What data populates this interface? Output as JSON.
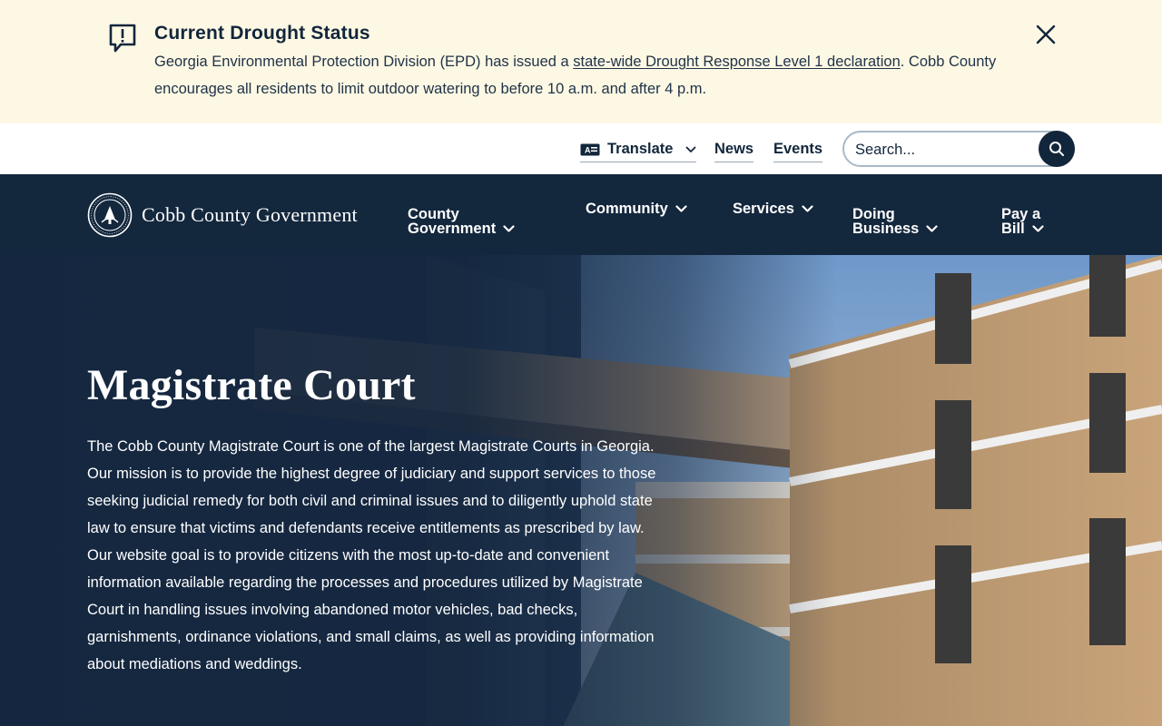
{
  "alert": {
    "title": "Current Drought Status",
    "text_before": "Georgia Environmental Protection Division (EPD) has issued a ",
    "link_text": "state-wide Drought Response Level 1 declaration",
    "text_after": ". Cobb County encourages all residents to limit outdoor watering to before 10 a.m. and after 4 p.m.",
    "background_color": "#fdf8e4",
    "icon": "alert-speech-bubble-icon"
  },
  "utility": {
    "translate_label": "Translate",
    "news_label": "News",
    "events_label": "Events",
    "search_placeholder": "Search..."
  },
  "nav": {
    "logo_text": "Cobb County Government",
    "items": [
      {
        "line1": "County",
        "line2": "Government"
      },
      {
        "line1": "Community"
      },
      {
        "line1": "Services"
      },
      {
        "line1": "Doing",
        "line2": "Business"
      },
      {
        "line1": "Pay a",
        "line2": "Bill"
      }
    ],
    "background_color": "#13273d"
  },
  "hero": {
    "title": "Magistrate Court",
    "description": "The Cobb County Magistrate Court is one of the largest Magistrate Courts in Georgia. Our mission is to provide the highest degree of judiciary and support services to those seeking judicial remedy for both civil and criminal issues and to diligently uphold state law to ensure that victims and defendants receive entitlements as prescribed by law. Our website goal is to provide citizens with the most up-to-date and convenient information available regarding the processes and procedures utilized by Magistrate Court in handling issues involving abandoned motor vehicles, bad checks, garnishments, ordinance violations, and small claims, as well as providing information about mediations and weddings."
  }
}
